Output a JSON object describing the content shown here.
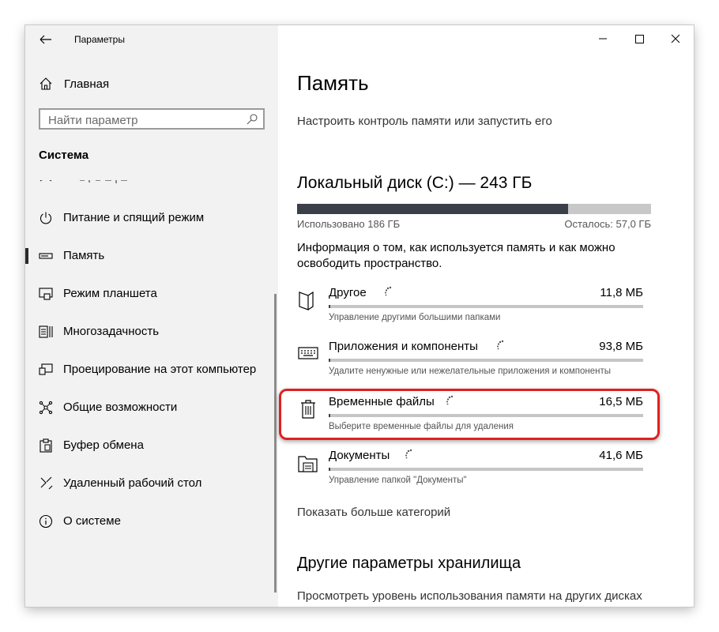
{
  "window": {
    "title": "Параметры"
  },
  "sidebar": {
    "home_label": "Главная",
    "search_placeholder": "Найти параметр",
    "section_header": "Система",
    "items": [
      {
        "label": "Питание и спящий режим",
        "icon": "power-icon"
      },
      {
        "label": "Память",
        "icon": "storage-icon",
        "selected": true
      },
      {
        "label": "Режим планшета",
        "icon": "tablet-mode-icon"
      },
      {
        "label": "Многозадачность",
        "icon": "multitasking-icon"
      },
      {
        "label": "Проецирование на этот компьютер",
        "icon": "projecting-icon"
      },
      {
        "label": "Общие возможности",
        "icon": "shared-experiences-icon"
      },
      {
        "label": "Буфер обмена",
        "icon": "clipboard-icon"
      },
      {
        "label": "Удаленный рабочий стол",
        "icon": "remote-desktop-icon"
      },
      {
        "label": "О системе",
        "icon": "about-icon"
      }
    ]
  },
  "main": {
    "page_title": "Память",
    "storage_sense_link": "Настроить контроль памяти или запустить его",
    "disk": {
      "title": "Локальный диск (C:) — 243 ГБ",
      "used_text": "Использовано 186 ГБ",
      "free_text": "Осталось: 57,0 ГБ",
      "used_fraction": 0.765
    },
    "info_text": "Информация о том, как используется память и как можно освободить пространство.",
    "categories": [
      {
        "name": "Другое",
        "size": "11,8 МБ",
        "description": "Управление другими большими папками",
        "icon": "other-folder-icon"
      },
      {
        "name": "Приложения и компоненты",
        "size": "93,8 МБ",
        "description": "Удалите ненужные или нежелательные приложения и компоненты",
        "icon": "apps-keyboard-icon"
      },
      {
        "name": "Временные файлы",
        "size": "16,5 МБ",
        "description": "Выберите временные файлы для удаления",
        "icon": "trash-icon",
        "highlighted": true
      },
      {
        "name": "Документы",
        "size": "41,6 МБ",
        "description": "Управление папкой \"Документы\"",
        "icon": "documents-icon"
      }
    ],
    "show_more_link": "Показать больше категорий",
    "other_settings_title": "Другие параметры хранилища",
    "other_settings_link": "Просмотреть уровень использования памяти на других дисках"
  },
  "colors": {
    "sidebar_bg": "#f2f2f2",
    "bar_fill": "#3a3f4a",
    "bar_track": "#c8c8c8",
    "highlight": "#e02020"
  }
}
